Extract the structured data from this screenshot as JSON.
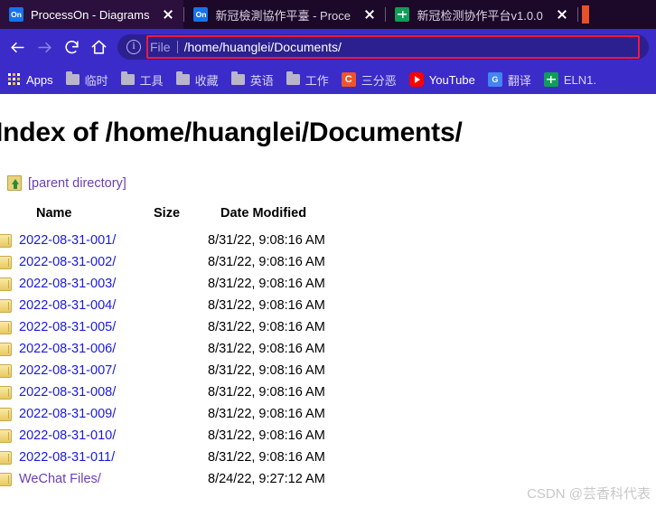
{
  "browser": {
    "tabs": [
      {
        "title": "ProcessOn - Diagrams",
        "favicon": "processon-icon",
        "active": true
      },
      {
        "title": "新冠檢測協作平臺 - Process",
        "favicon": "processon-icon",
        "active": false
      },
      {
        "title": "新冠检测协作平台v1.0.0",
        "favicon": "google-sheets-icon",
        "active": false
      }
    ],
    "toolbar": {
      "back_icon": "back-arrow-icon",
      "forward_icon": "forward-arrow-icon",
      "reload_icon": "reload-icon",
      "home_icon": "home-icon",
      "site_info_icon": "info-circle-icon",
      "url_scheme": "File",
      "url_path": "/home/huanglei/Documents/",
      "url_highlight_color": "#f2183f"
    },
    "bookmarks": [
      {
        "label": "Apps",
        "icon": "apps-grid-icon"
      },
      {
        "label": "临时",
        "icon": "folder-icon"
      },
      {
        "label": "工具",
        "icon": "folder-icon"
      },
      {
        "label": "收藏",
        "icon": "folder-icon"
      },
      {
        "label": "英语",
        "icon": "folder-icon"
      },
      {
        "label": "工作",
        "icon": "folder-icon"
      },
      {
        "label": "三分恶",
        "icon": "csdn-icon"
      },
      {
        "label": "YouTube",
        "icon": "youtube-icon"
      },
      {
        "label": "翻译",
        "icon": "google-translate-icon"
      },
      {
        "label": "ELN1.",
        "icon": "google-sheets-icon"
      }
    ],
    "theme": {
      "tabstrip_bg": "#1c0829",
      "toolbar_bg": "#3b2bc9",
      "urlbar_bg": "#2c2090"
    }
  },
  "page": {
    "title": "Index of /home/huanglei/Documents/",
    "parent_link": "[parent directory]",
    "parent_icon": "folder-up-icon",
    "columns": [
      "Name",
      "Size",
      "Date Modified"
    ],
    "rows": [
      {
        "name": "2022-08-31-001/",
        "size": "",
        "date": "8/31/22, 9:08:16 AM",
        "visited": false
      },
      {
        "name": "2022-08-31-002/",
        "size": "",
        "date": "8/31/22, 9:08:16 AM",
        "visited": false
      },
      {
        "name": "2022-08-31-003/",
        "size": "",
        "date": "8/31/22, 9:08:16 AM",
        "visited": false
      },
      {
        "name": "2022-08-31-004/",
        "size": "",
        "date": "8/31/22, 9:08:16 AM",
        "visited": false
      },
      {
        "name": "2022-08-31-005/",
        "size": "",
        "date": "8/31/22, 9:08:16 AM",
        "visited": false
      },
      {
        "name": "2022-08-31-006/",
        "size": "",
        "date": "8/31/22, 9:08:16 AM",
        "visited": false
      },
      {
        "name": "2022-08-31-007/",
        "size": "",
        "date": "8/31/22, 9:08:16 AM",
        "visited": false
      },
      {
        "name": "2022-08-31-008/",
        "size": "",
        "date": "8/31/22, 9:08:16 AM",
        "visited": false
      },
      {
        "name": "2022-08-31-009/",
        "size": "",
        "date": "8/31/22, 9:08:16 AM",
        "visited": false
      },
      {
        "name": "2022-08-31-010/",
        "size": "",
        "date": "8/31/22, 9:08:16 AM",
        "visited": false
      },
      {
        "name": "2022-08-31-011/",
        "size": "",
        "date": "8/31/22, 9:08:16 AM",
        "visited": false
      },
      {
        "name": "WeChat Files/",
        "size": "",
        "date": "8/24/22, 9:27:12 AM",
        "visited": true
      }
    ],
    "link_color": "#1a1ae0",
    "visited_link_color": "#6a3fb5"
  },
  "watermark": "CSDN @芸香科代表"
}
